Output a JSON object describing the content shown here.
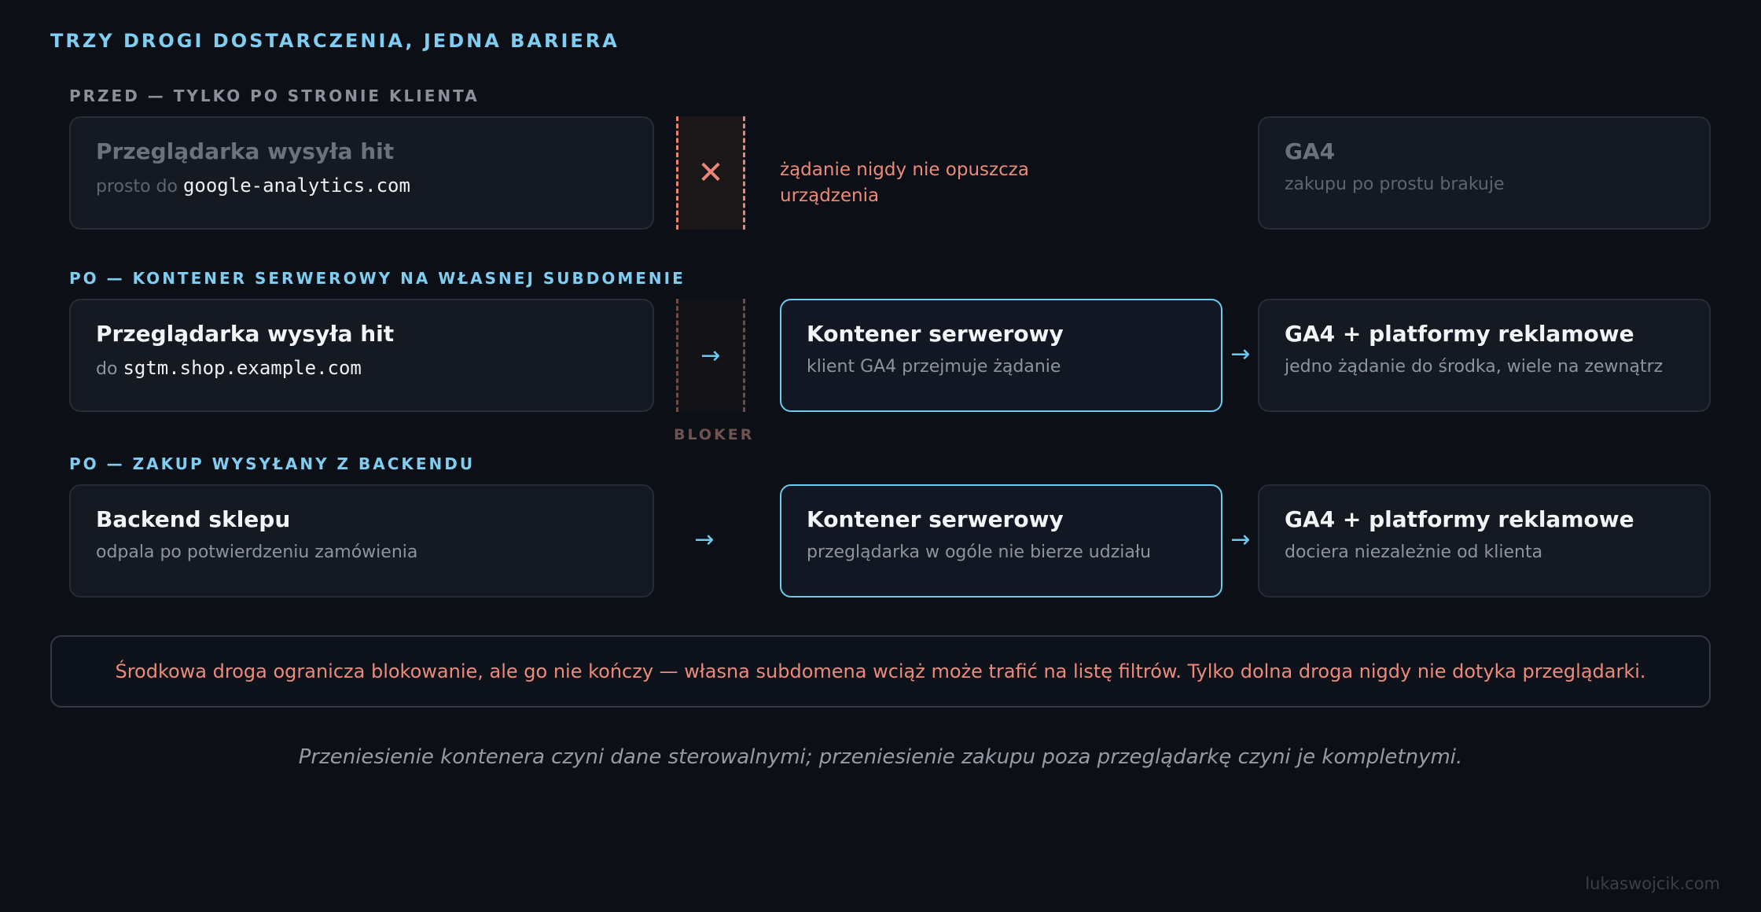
{
  "title": "TRZY DROGI DOSTARCZENIA, JEDNA BARIERA",
  "rows": [
    {
      "label": "PRZED — TYLKO PO STRONIE KLIENTA",
      "source": {
        "title": "Przeglądarka wysyła hit",
        "sub_prefix": "prosto do",
        "sub_code": "google-analytics.com"
      },
      "blocked_note": "żądanie nigdy nie opuszcza urządzenia",
      "destination": {
        "title": "GA4",
        "sub": "zakupu po prostu brakuje"
      }
    },
    {
      "label": "PO — KONTENER SERWEROWY NA WŁASNEJ SUBDOMENIE",
      "source": {
        "title": "Przeglądarka wysyła hit",
        "sub_prefix": "do",
        "sub_code": "sgtm.shop.example.com"
      },
      "middle": {
        "title": "Kontener serwerowy",
        "sub": "klient GA4 przejmuje żądanie"
      },
      "destination": {
        "title": "GA4 + platformy reklamowe",
        "sub": "jedno żądanie do środka, wiele na zewnątrz"
      },
      "blocker_label": "BLOKER"
    },
    {
      "label": "PO — ZAKUP WYSYŁANY Z BACKENDU",
      "source": {
        "title": "Backend sklepu",
        "sub": "odpala po potwierdzeniu zamówienia"
      },
      "middle": {
        "title": "Kontener serwerowy",
        "sub": "przeglądarka w ogóle nie bierze udziału"
      },
      "destination": {
        "title": "GA4 + platformy reklamowe",
        "sub": "dociera niezależnie od klienta"
      }
    }
  ],
  "symbols": {
    "blocked": "✕",
    "arrow": "→"
  },
  "note": "Środkowa droga ogranicza blokowanie, ale go nie kończy — własna subdomena wciąż może trafić na listę filtrów. Tylko dolna droga nigdy nie dotyka przeglądarki.",
  "quote": "Przeniesienie kontenera czyni dane sterowalnymi; przeniesienie zakupu poza przeglądarkę czyni je kompletnymi.",
  "footer": "lukaswojcik.com",
  "colors": {
    "accent": "#6ccaef",
    "warning": "#ec8b7a",
    "background": "#0c0f16"
  }
}
